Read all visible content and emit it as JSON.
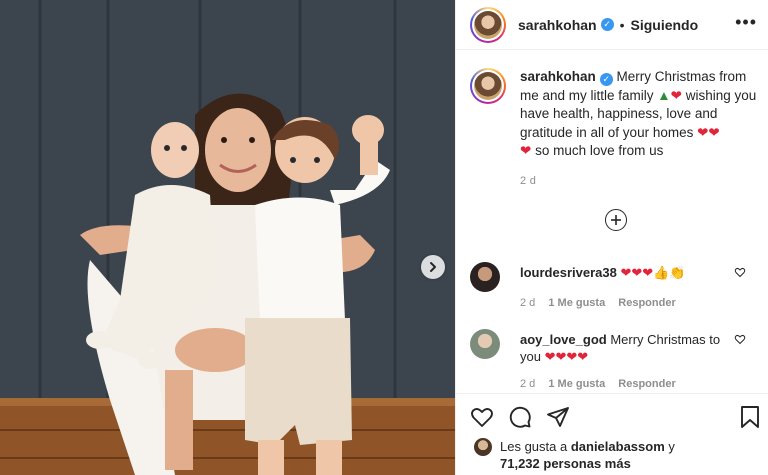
{
  "post": {
    "author": "sarahkohan",
    "follow_status": "Siguiendo",
    "more_glyph": "•••"
  },
  "caption": {
    "author": "sarahkohan",
    "text_part1": " Merry Christmas from me and my little family ",
    "text_part2": " wishing you have health, happiness, love and gratitude in all of your homes ",
    "text_part3": " so much love from us",
    "time": "2 d"
  },
  "comments": [
    {
      "user": "lourdesrivera38",
      "text": "",
      "emojis": "❤❤❤👍👏",
      "time": "2 d",
      "likes": "1 Me gusta",
      "reply": "Responder"
    },
    {
      "user": "aoy_love_god",
      "text": " Merry Christmas to you",
      "emojis": "❤❤❤❤",
      "time": "2 d",
      "likes": "1 Me gusta",
      "reply": "Responder"
    }
  ],
  "likes": {
    "prefix": "Les gusta a ",
    "user": "danielabassom",
    "suffix": " y",
    "count": "71,232 personas más"
  },
  "colors": {
    "accent_blue": "#3897f0",
    "heart_red": "#e0243a",
    "text": "#262626",
    "muted": "#8e8e8e"
  },
  "icons": [
    "next-arrow-icon",
    "verified-icon",
    "more-options-icon",
    "add-circle-icon",
    "heart-icon",
    "comment-icon",
    "share-icon",
    "bookmark-icon"
  ]
}
